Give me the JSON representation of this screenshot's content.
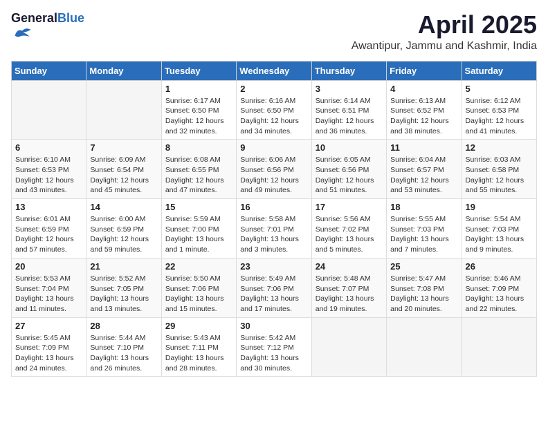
{
  "header": {
    "logo_general": "General",
    "logo_blue": "Blue",
    "title": "April 2025",
    "location": "Awantipur, Jammu and Kashmir, India"
  },
  "weekdays": [
    "Sunday",
    "Monday",
    "Tuesday",
    "Wednesday",
    "Thursday",
    "Friday",
    "Saturday"
  ],
  "weeks": [
    [
      {
        "day": "",
        "info": ""
      },
      {
        "day": "",
        "info": ""
      },
      {
        "day": "1",
        "info": "Sunrise: 6:17 AM\nSunset: 6:50 PM\nDaylight: 12 hours\nand 32 minutes."
      },
      {
        "day": "2",
        "info": "Sunrise: 6:16 AM\nSunset: 6:50 PM\nDaylight: 12 hours\nand 34 minutes."
      },
      {
        "day": "3",
        "info": "Sunrise: 6:14 AM\nSunset: 6:51 PM\nDaylight: 12 hours\nand 36 minutes."
      },
      {
        "day": "4",
        "info": "Sunrise: 6:13 AM\nSunset: 6:52 PM\nDaylight: 12 hours\nand 38 minutes."
      },
      {
        "day": "5",
        "info": "Sunrise: 6:12 AM\nSunset: 6:53 PM\nDaylight: 12 hours\nand 41 minutes."
      }
    ],
    [
      {
        "day": "6",
        "info": "Sunrise: 6:10 AM\nSunset: 6:53 PM\nDaylight: 12 hours\nand 43 minutes."
      },
      {
        "day": "7",
        "info": "Sunrise: 6:09 AM\nSunset: 6:54 PM\nDaylight: 12 hours\nand 45 minutes."
      },
      {
        "day": "8",
        "info": "Sunrise: 6:08 AM\nSunset: 6:55 PM\nDaylight: 12 hours\nand 47 minutes."
      },
      {
        "day": "9",
        "info": "Sunrise: 6:06 AM\nSunset: 6:56 PM\nDaylight: 12 hours\nand 49 minutes."
      },
      {
        "day": "10",
        "info": "Sunrise: 6:05 AM\nSunset: 6:56 PM\nDaylight: 12 hours\nand 51 minutes."
      },
      {
        "day": "11",
        "info": "Sunrise: 6:04 AM\nSunset: 6:57 PM\nDaylight: 12 hours\nand 53 minutes."
      },
      {
        "day": "12",
        "info": "Sunrise: 6:03 AM\nSunset: 6:58 PM\nDaylight: 12 hours\nand 55 minutes."
      }
    ],
    [
      {
        "day": "13",
        "info": "Sunrise: 6:01 AM\nSunset: 6:59 PM\nDaylight: 12 hours\nand 57 minutes."
      },
      {
        "day": "14",
        "info": "Sunrise: 6:00 AM\nSunset: 6:59 PM\nDaylight: 12 hours\nand 59 minutes."
      },
      {
        "day": "15",
        "info": "Sunrise: 5:59 AM\nSunset: 7:00 PM\nDaylight: 13 hours\nand 1 minute."
      },
      {
        "day": "16",
        "info": "Sunrise: 5:58 AM\nSunset: 7:01 PM\nDaylight: 13 hours\nand 3 minutes."
      },
      {
        "day": "17",
        "info": "Sunrise: 5:56 AM\nSunset: 7:02 PM\nDaylight: 13 hours\nand 5 minutes."
      },
      {
        "day": "18",
        "info": "Sunrise: 5:55 AM\nSunset: 7:03 PM\nDaylight: 13 hours\nand 7 minutes."
      },
      {
        "day": "19",
        "info": "Sunrise: 5:54 AM\nSunset: 7:03 PM\nDaylight: 13 hours\nand 9 minutes."
      }
    ],
    [
      {
        "day": "20",
        "info": "Sunrise: 5:53 AM\nSunset: 7:04 PM\nDaylight: 13 hours\nand 11 minutes."
      },
      {
        "day": "21",
        "info": "Sunrise: 5:52 AM\nSunset: 7:05 PM\nDaylight: 13 hours\nand 13 minutes."
      },
      {
        "day": "22",
        "info": "Sunrise: 5:50 AM\nSunset: 7:06 PM\nDaylight: 13 hours\nand 15 minutes."
      },
      {
        "day": "23",
        "info": "Sunrise: 5:49 AM\nSunset: 7:06 PM\nDaylight: 13 hours\nand 17 minutes."
      },
      {
        "day": "24",
        "info": "Sunrise: 5:48 AM\nSunset: 7:07 PM\nDaylight: 13 hours\nand 19 minutes."
      },
      {
        "day": "25",
        "info": "Sunrise: 5:47 AM\nSunset: 7:08 PM\nDaylight: 13 hours\nand 20 minutes."
      },
      {
        "day": "26",
        "info": "Sunrise: 5:46 AM\nSunset: 7:09 PM\nDaylight: 13 hours\nand 22 minutes."
      }
    ],
    [
      {
        "day": "27",
        "info": "Sunrise: 5:45 AM\nSunset: 7:09 PM\nDaylight: 13 hours\nand 24 minutes."
      },
      {
        "day": "28",
        "info": "Sunrise: 5:44 AM\nSunset: 7:10 PM\nDaylight: 13 hours\nand 26 minutes."
      },
      {
        "day": "29",
        "info": "Sunrise: 5:43 AM\nSunset: 7:11 PM\nDaylight: 13 hours\nand 28 minutes."
      },
      {
        "day": "30",
        "info": "Sunrise: 5:42 AM\nSunset: 7:12 PM\nDaylight: 13 hours\nand 30 minutes."
      },
      {
        "day": "",
        "info": ""
      },
      {
        "day": "",
        "info": ""
      },
      {
        "day": "",
        "info": ""
      }
    ]
  ]
}
